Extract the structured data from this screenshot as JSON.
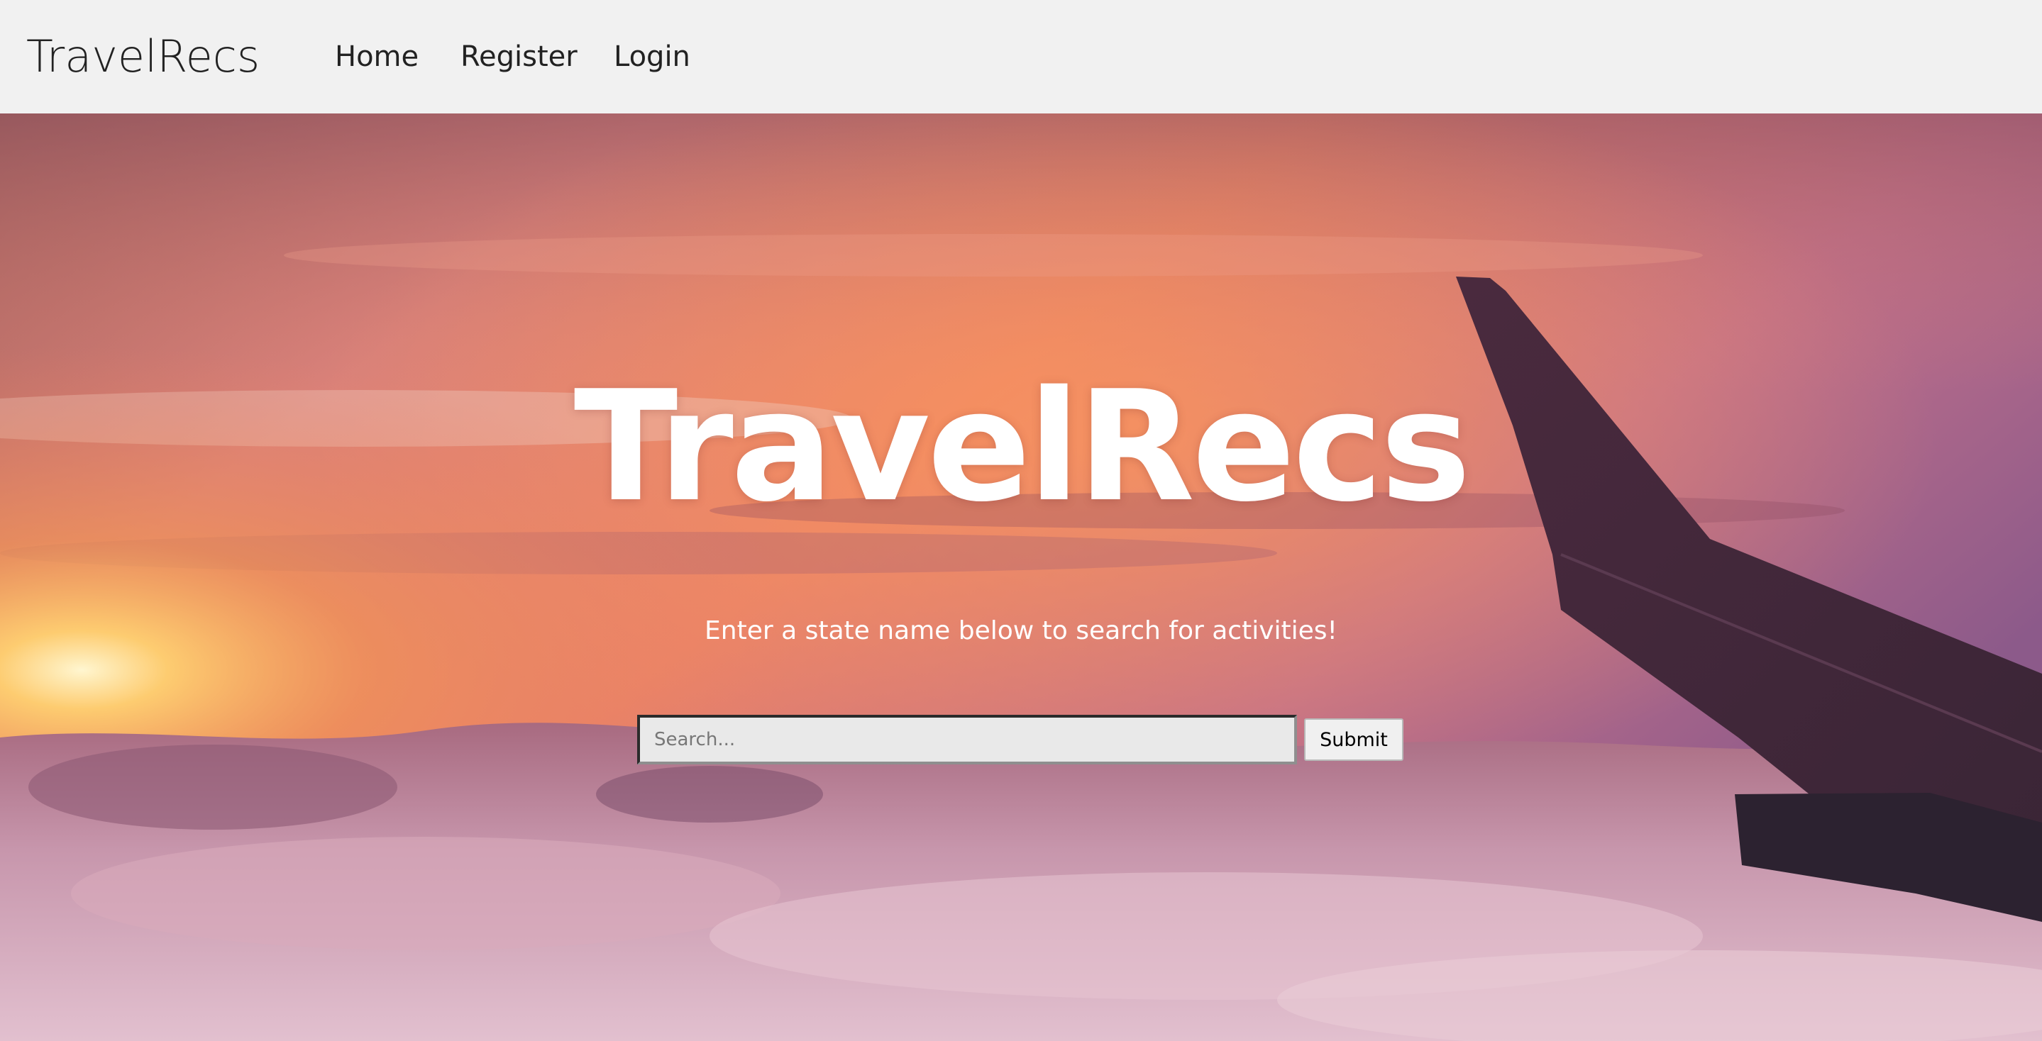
{
  "navbar": {
    "brand": "TravelRecs",
    "links": [
      "Home",
      "Register",
      "Login"
    ]
  },
  "hero": {
    "title": "TravelRecs",
    "subtitle": "Enter a state name below to search for activities!",
    "search": {
      "placeholder": "Search...",
      "value": ""
    },
    "submit_label": "Submit",
    "background": "sunset-sky-above-clouds-with-airplane-wing"
  },
  "colors": {
    "navbar_bg": "#f1f1f1",
    "text_dark": "#222222",
    "hero_text": "#ffffff"
  }
}
